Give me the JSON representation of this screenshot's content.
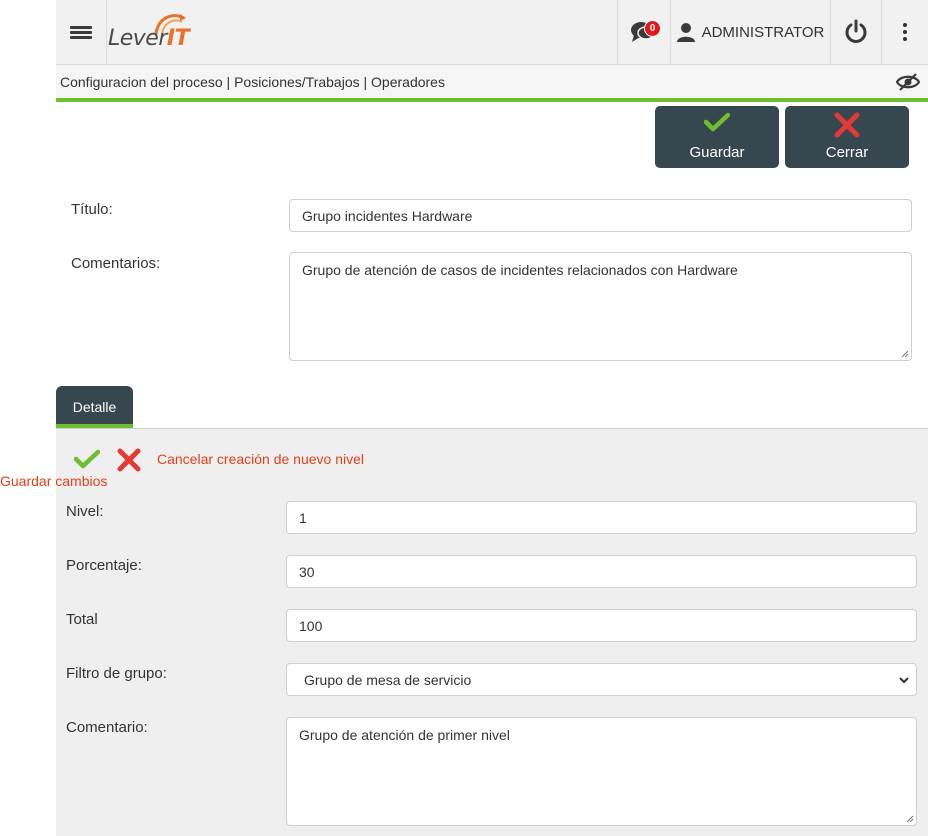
{
  "header": {
    "logo_main": "Lever",
    "logo_accent": "IT",
    "notification_count": "0",
    "user_label": "ADMINISTRATOR"
  },
  "breadcrumb": "Configuracion del proceso | Posiciones/Trabajos | Operadores",
  "toolbar": {
    "save_label": "Guardar",
    "close_label": "Cerrar"
  },
  "form": {
    "title_label": "Título:",
    "title_value": "Grupo incidentes Hardware",
    "comments_label": "Comentarios:",
    "comments_value": "Grupo de atención de casos de incidentes relacionados con Hardware"
  },
  "tabs": [
    {
      "label": "Detalle"
    }
  ],
  "detail": {
    "save_changes_label": "Guardar cambios",
    "cancel_label": "Cancelar creación de nuevo nivel",
    "level_label": "Nivel:",
    "level_value": "1",
    "percent_label": "Porcentaje:",
    "percent_value": "30",
    "total_label": "Total",
    "total_value": "100",
    "group_filter_label": "Filtro de grupo:",
    "group_filter_value": "Grupo de mesa de servicio",
    "comment_label": "Comentario:",
    "comment_value": "Grupo de atención de primer nivel"
  },
  "colors": {
    "accent_green": "#6fbe2e",
    "dark_button": "#37474f",
    "danger_red": "#e0401a",
    "logo_orange": "#e8722a"
  },
  "icons": [
    "menu-icon",
    "chat-icon",
    "user-icon",
    "power-icon",
    "more-vert-icon",
    "eye-slash-icon",
    "check-icon",
    "close-icon"
  ]
}
